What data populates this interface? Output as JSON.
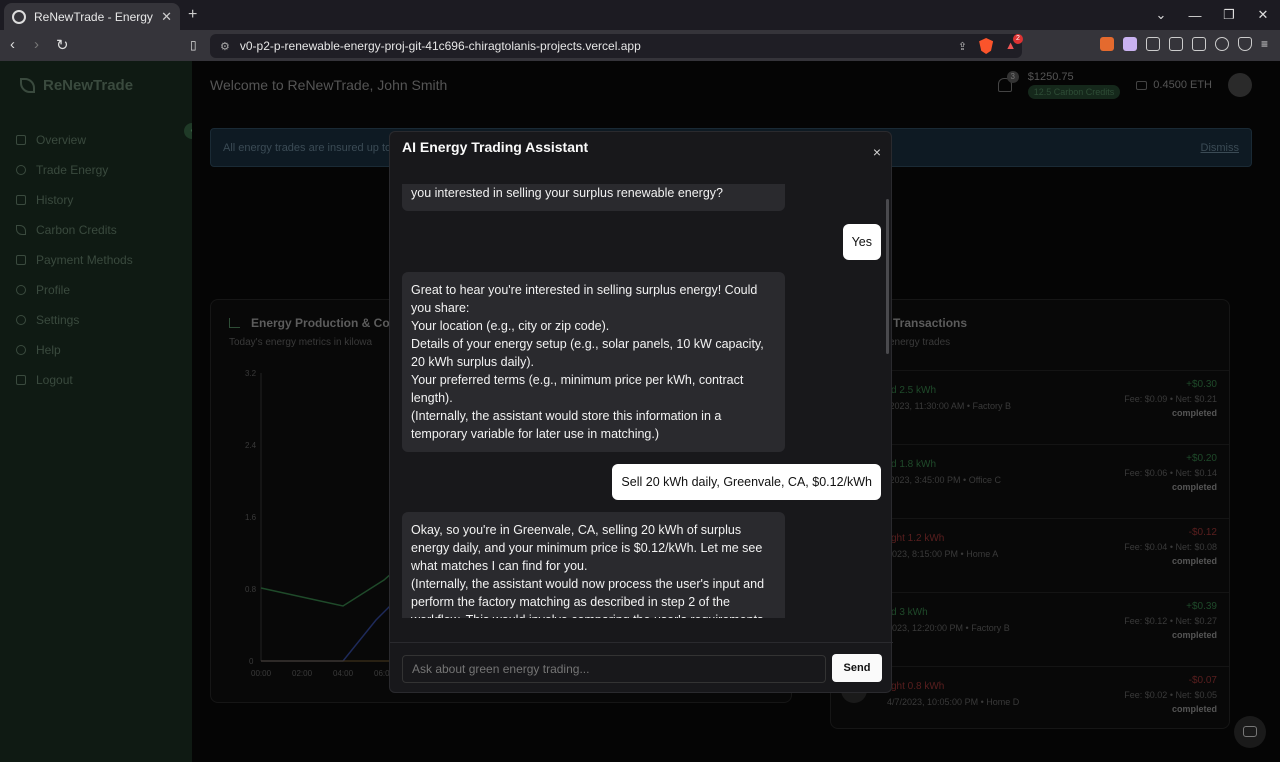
{
  "browser": {
    "tab_title": "ReNewTrade - Energy trading I",
    "url": "v0-p2-p-renewable-energy-proj-git-41c696-chiragtolanis-projects.vercel.app",
    "extension_badge": "2"
  },
  "app": {
    "brand": "ReNewTrade",
    "welcome": "Welcome to ReNewTrade, John Smith",
    "notifications_count": "3",
    "balance": "$1250.75",
    "carbon_credits": "12.5 Carbon Credits",
    "eth": "0.4500 ETH"
  },
  "sidebar": {
    "items": [
      {
        "label": "Overview",
        "icon": "grid-icon"
      },
      {
        "label": "Trade Energy",
        "icon": "refresh-icon"
      },
      {
        "label": "History",
        "icon": "bar-chart-icon"
      },
      {
        "label": "Carbon Credits",
        "icon": "leaf-icon"
      },
      {
        "label": "Payment Methods",
        "icon": "credit-card-icon"
      },
      {
        "label": "Profile",
        "icon": "user-icon"
      },
      {
        "label": "Settings",
        "icon": "gear-icon"
      },
      {
        "label": "Help",
        "icon": "help-icon"
      },
      {
        "label": "Logout",
        "icon": "logout-icon"
      }
    ]
  },
  "banner": {
    "text": "All energy trades are insured up to",
    "dismiss": "Dismiss"
  },
  "production_card": {
    "title": "Energy Production & Cons",
    "subtitle": "Today's energy metrics in kilowa",
    "y_ticks": [
      "3.2",
      "2.4",
      "1.6",
      "0.8",
      "0"
    ],
    "x_ticks": [
      "00:00",
      "02:00",
      "04:00",
      "06:0"
    ]
  },
  "transactions_card": {
    "title": "Transactions",
    "subtitle": "energy trades",
    "items": [
      {
        "name": "d 2.5 kWh",
        "meta": "/2023, 11:30:00 AM • Factory B",
        "amount": "+$0.30",
        "fee": "Fee: $0.09 • Net: $0.21",
        "status": "completed",
        "tone": "green"
      },
      {
        "name": "d 1.8 kWh",
        "meta": "/2023, 3:45:00 PM • Office C",
        "amount": "+$0.20",
        "fee": "Fee: $0.06 • Net: $0.14",
        "status": "completed",
        "tone": "green"
      },
      {
        "name": "ght 1.2 kWh",
        "meta": "2023, 8:15:00 PM • Home A",
        "amount": "-$0.12",
        "fee": "Fee: $0.04 • Net: $0.08",
        "status": "completed",
        "tone": "red"
      },
      {
        "name": "d 3 kWh",
        "meta": "2023, 12:20:00 PM • Factory B",
        "amount": "+$0.39",
        "fee": "Fee: $0.12 • Net: $0.27",
        "status": "completed",
        "tone": "green"
      },
      {
        "name": "ght 0.8 kWh",
        "meta": "4/7/2023, 10:05:00 PM • Home D",
        "amount": "-$0.07",
        "fee": "Fee: $0.02 • Net: $0.05",
        "status": "completed",
        "tone": "red"
      }
    ]
  },
  "modal": {
    "title": "AI Energy Trading Assistant",
    "close": "×",
    "messages": [
      {
        "role": "ai",
        "lines": [
          "you interested in selling your surplus renewable energy?"
        ]
      },
      {
        "role": "me",
        "lines": [
          "Yes"
        ]
      },
      {
        "role": "ai",
        "lines": [
          "Great to hear you're interested in selling surplus energy! Could you share:",
          "Your location (e.g., city or zip code).",
          "Details of your energy setup (e.g., solar panels, 10 kW capacity, 20 kWh surplus daily).",
          "Your preferred terms (e.g., minimum price per kWh, contract length).",
          "(Internally, the assistant would store this information in a temporary variable for later use in matching.)"
        ]
      },
      {
        "role": "me",
        "lines": [
          "Sell 20 kWh daily, Greenvale, CA, $0.12/kWh"
        ]
      },
      {
        "role": "ai",
        "lines": [
          "Okay, so you're in Greenvale, CA, selling 20 kWh of surplus energy daily, and your minimum price is $0.12/kWh. Let me see what matches I can find for you.",
          "(Internally, the assistant would now process the user's input and perform the factory matching as described in step 2 of the workflow. This would involve comparing the user's requirements"
        ]
      }
    ],
    "input_placeholder": "Ask about green energy trading...",
    "send_label": "Send"
  }
}
